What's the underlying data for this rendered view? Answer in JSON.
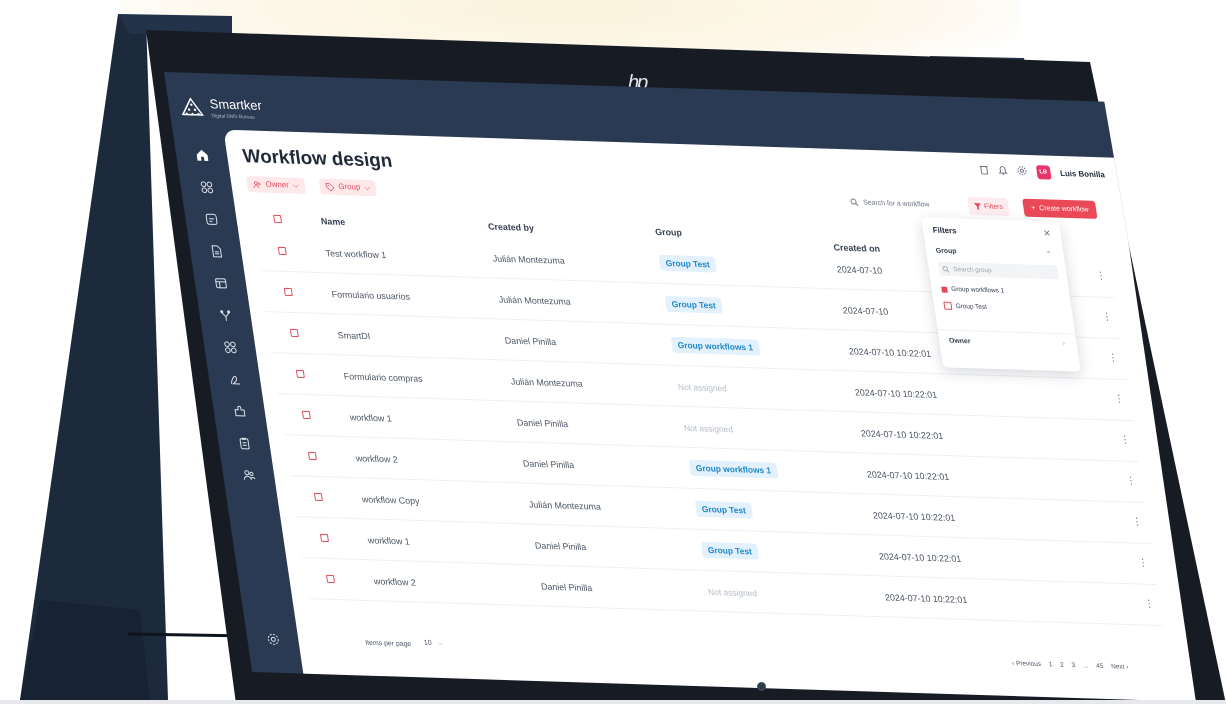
{
  "brand": {
    "name": "Smartker",
    "subtitle": "Digital DMS Bureau"
  },
  "device_logo": "hp",
  "page": {
    "title": "Workflow design"
  },
  "filters_chips": [
    {
      "label": "Owner",
      "icon": "users-icon"
    },
    {
      "label": "Group",
      "icon": "tag-icon"
    }
  ],
  "header": {
    "icons": [
      "trash-icon",
      "bell-icon",
      "gear-icon"
    ],
    "user": {
      "initials": "LB",
      "name": "Luis Bonilla",
      "avatar_color": "#e8336b"
    }
  },
  "toolbar": {
    "search_placeholder": "Search for a workflow",
    "filters_label": "Filters",
    "create_label": "Create workflow"
  },
  "table": {
    "columns": [
      "Name",
      "Created by",
      "Group",
      "Created on"
    ],
    "rows": [
      {
        "name": "Test workflow 1",
        "created_by": "Julián Montezuma",
        "group": "Group Test",
        "created_on": "2024-07-10"
      },
      {
        "name": "Formulario usuarios",
        "created_by": "Julián Montezuma",
        "group": "Group Test",
        "created_on": "2024-07-10"
      },
      {
        "name": "SmartDI",
        "created_by": "Daniel Pinilla",
        "group": "Group workflows 1",
        "created_on": "2024-07-10 10:22:01"
      },
      {
        "name": "Formulario compras",
        "created_by": "Julián Montezuma",
        "group": "Not assigned",
        "created_on": "2024-07-10 10:22:01"
      },
      {
        "name": "workflow 1",
        "created_by": "Daniel Pinilla",
        "group": "Not assigned",
        "created_on": "2024-07-10 10:22:01"
      },
      {
        "name": "workflow 2",
        "created_by": "Daniel Pinilla",
        "group": "Group workflows 1",
        "created_on": "2024-07-10 10:22:01"
      },
      {
        "name": "workflow Copy",
        "created_by": "Julián Montezuma",
        "group": "Group Test",
        "created_on": "2024-07-10 10:22:01"
      },
      {
        "name": "workflow 1",
        "created_by": "Daniel Pinilla",
        "group": "Group Test",
        "created_on": "2024-07-10 10:22:01"
      },
      {
        "name": "workflow 2",
        "created_by": "Daniel Pinilla",
        "group": "Not assigned",
        "created_on": "2024-07-10 10:22:01"
      }
    ]
  },
  "pagination": {
    "items_per_page_label": "Items per page",
    "items_per_page_value": "10",
    "previous_label": "Previous",
    "next_label": "Next",
    "pages": [
      "1",
      "2",
      "3",
      "...",
      "45"
    ]
  },
  "filter_popover": {
    "title": "Filters",
    "group_label": "Group",
    "search_placeholder": "Search group",
    "options": [
      {
        "label": "Group workflows 1",
        "checked": true
      },
      {
        "label": "Group Test",
        "checked": false
      }
    ],
    "owner_label": "Owner"
  },
  "sidebar_icons": [
    "home-icon",
    "apps-icon",
    "calendar-icon",
    "document-icon",
    "table-icon",
    "workflow-icon",
    "grid-icon",
    "signature-icon",
    "puzzle-icon",
    "clipboard-icon",
    "users-icon"
  ],
  "sidebar_bottom_icon": "settings-icon",
  "colors": {
    "accent": "#e24a5a",
    "sidebar": "#2b3a53",
    "badge_blue": "#1e88c9"
  }
}
